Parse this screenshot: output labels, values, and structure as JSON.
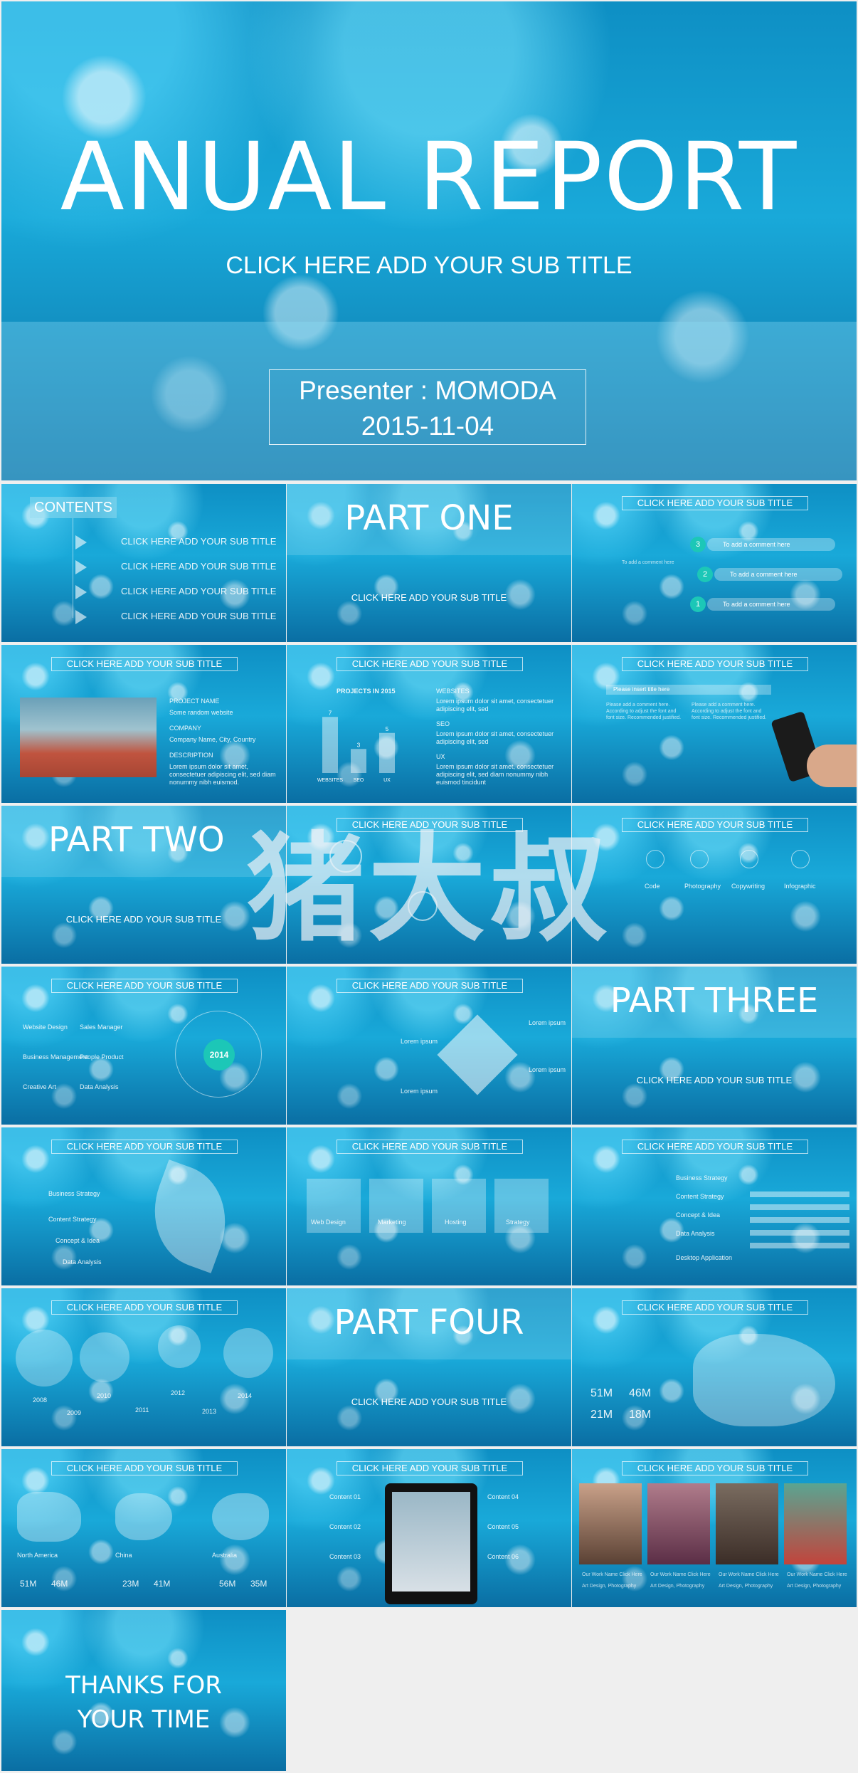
{
  "hero": {
    "title": "ANUAL REPORT",
    "subtitle": "CLICK HERE ADD YOUR SUB TITLE",
    "presenter": "Presenter : MOMODA",
    "date": "2015-11-04"
  },
  "sub_title": "CLICK HERE ADD YOUR SUB TITLE",
  "contents": {
    "label": "CONTENTS",
    "items": [
      "CLICK HERE ADD YOUR SUB TITLE",
      "CLICK HERE ADD YOUR SUB TITLE",
      "CLICK HERE ADD YOUR SUB TITLE",
      "CLICK HERE ADD YOUR SUB TITLE"
    ]
  },
  "parts": {
    "one": "PART ONE",
    "two": "PART TWO",
    "three": "PART THREE",
    "four": "PART FOUR"
  },
  "comments": {
    "left": "To add a comment here",
    "items": [
      "To add a comment here",
      "To add a comment here",
      "To add a comment here"
    ],
    "nums": [
      "3",
      "2",
      "1"
    ]
  },
  "project": {
    "lines": [
      "PROJECT NAME",
      "Some random website",
      "COMPANY",
      "Company Name, City, Country",
      "DESCRIPTION",
      "Lorem ipsum dolor sit amet, consectetuer adipiscing elit, sed diam nonummy nibh euismod."
    ]
  },
  "projects2015": {
    "title": "PROJECTS IN 2015",
    "bars": [
      {
        "label": "WEBSITES",
        "value": 7
      },
      {
        "label": "SEO",
        "value": 3
      },
      {
        "label": "UX",
        "value": 5
      }
    ],
    "right": [
      "WEBSITES",
      "Lorem ipsum dolor sit amet, consectetuer adipiscing elit, sed",
      "SEO",
      "Lorem ipsum dolor sit amet, consectetuer adipiscing elit, sed",
      "UX",
      "Lorem ipsum dolor sit amet, consectetuer adipiscing elit, sed diam nonummy nibh euismod tincidunt"
    ]
  },
  "phone_slide": {
    "insert": "Please insert title here",
    "text": "Please add a comment here. According to adjust the font and font size. Recommended justified."
  },
  "icons_row": [
    "Code",
    "Photography",
    "Copywriting",
    "Infographic"
  ],
  "year": "2014",
  "services": [
    "Website Design",
    "Sales Manager",
    "Business Management",
    "People Product",
    "Creative Art",
    "Data Analysis"
  ],
  "lorem": [
    "Lorem ipsum",
    "Lorem ipsum",
    "Lorem ipsum",
    "Lorem ipsum"
  ],
  "strategy_left": [
    "Business Strategy",
    "Content Strategy",
    "Concept & Idea",
    "Data Analysis"
  ],
  "boxes": [
    "Web Design",
    "Marketing",
    "Hosting",
    "Strategy"
  ],
  "strategy_right": [
    "Business Strategy",
    "Content Strategy",
    "Concept & Idea",
    "Data Analysis",
    "Desktop Application"
  ],
  "timeline": [
    "2008",
    "2009",
    "2010",
    "2011",
    "2012",
    "2013",
    "2014"
  ],
  "china_stats": [
    "51M",
    "46M",
    "21M",
    "18M"
  ],
  "regions": [
    {
      "name": "North America",
      "a": "51M",
      "b": "46M"
    },
    {
      "name": "China",
      "a": "23M",
      "b": "41M"
    },
    {
      "name": "Australia",
      "a": "56M",
      "b": "35M"
    }
  ],
  "tablet_contents": [
    "Content 01",
    "Content 02",
    "Content 03",
    "Content 04",
    "Content 05",
    "Content 06"
  ],
  "gallery": {
    "name": "Our Work Name Click Here",
    "cat": "Art Design, Photography"
  },
  "thanks": [
    "THANKS FOR",
    "YOUR TIME"
  ],
  "watermark": "猪大叔",
  "colors": {
    "accent": "#1cc7b7",
    "bg": "#0d8dc2"
  }
}
